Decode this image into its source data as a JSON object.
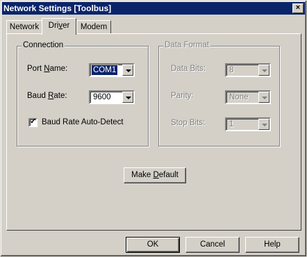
{
  "window": {
    "title": "Network Settings [Toolbus]",
    "close_glyph": "×"
  },
  "tabs": [
    {
      "label": "Network",
      "active": false
    },
    {
      "label_pre": "Dri",
      "label_mnem": "v",
      "label_post": "er",
      "active": true
    },
    {
      "label": "Modem",
      "active": false
    }
  ],
  "connection": {
    "title": "Connection",
    "port_name": {
      "label_pre": "Port ",
      "label_mnem": "N",
      "label_post": "ame:",
      "value": "COM1"
    },
    "baud_rate": {
      "label_pre": "Baud ",
      "label_mnem": "R",
      "label_post": "ate:",
      "value": "9600"
    },
    "auto_detect": {
      "label": "Baud Rate Auto-Detect",
      "checked": true,
      "tick": "✓"
    }
  },
  "data_format": {
    "title": "Data Format",
    "data_bits": {
      "label": "Data Bits:",
      "value": "8"
    },
    "parity": {
      "label": "Parity:",
      "value": "None"
    },
    "stop_bits": {
      "label": "Stop Bits:",
      "value": "1"
    }
  },
  "make_default": {
    "label_pre": "Make ",
    "label_mnem": "D",
    "label_post": "efault"
  },
  "footer": {
    "ok": "OK",
    "cancel": "Cancel",
    "help": "Help"
  }
}
